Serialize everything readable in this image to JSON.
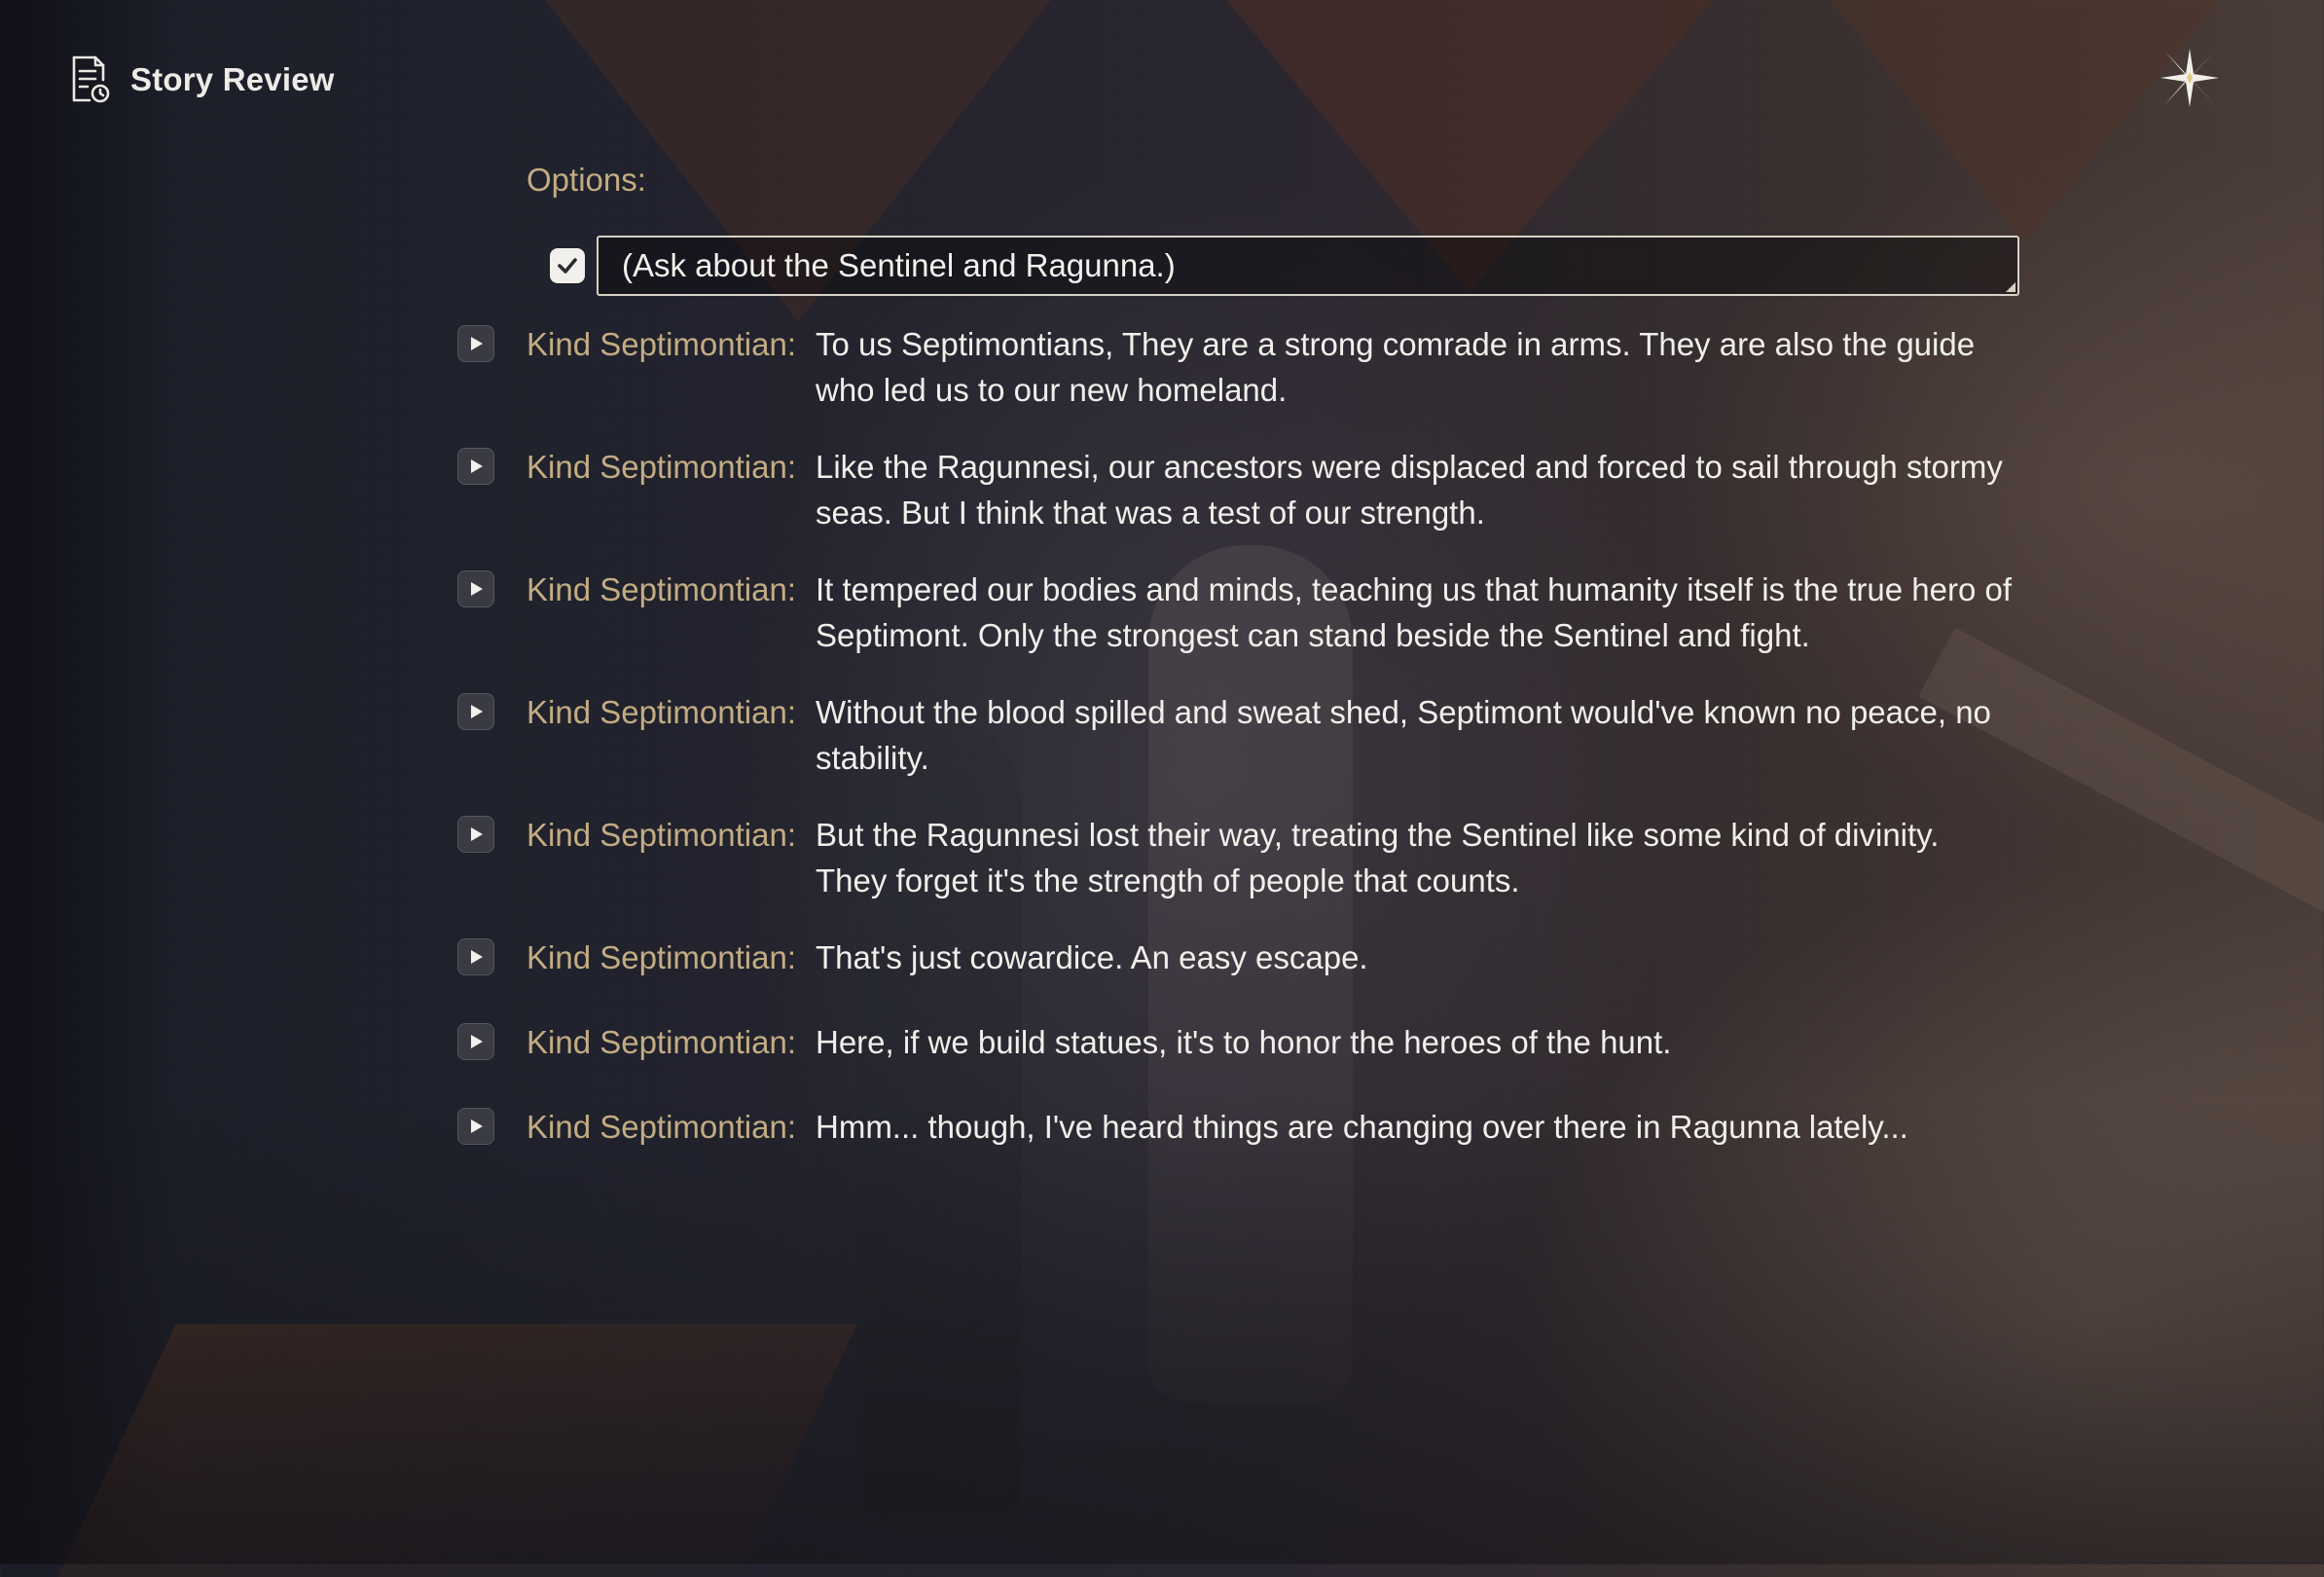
{
  "header": {
    "title": "Story Review",
    "icon": "story-document-icon"
  },
  "close": {
    "icon": "close-star-icon"
  },
  "options": {
    "label": "Options:",
    "selected_option": "(Ask about the Sentinel and Ragunna.)",
    "checked": true
  },
  "dialogue": [
    {
      "speaker": "Kind Septimontian:",
      "text": "To us Septimontians, They are a strong comrade in arms. They are also the guide who led us to our new homeland."
    },
    {
      "speaker": "Kind Septimontian:",
      "text": "Like the Ragunnesi, our ancestors were displaced and forced to sail through stormy seas. But I think that was a test of our strength."
    },
    {
      "speaker": "Kind Septimontian:",
      "text": "It tempered our bodies and minds, teaching us that humanity itself is the true hero of Septimont. Only the strongest can stand beside the Sentinel and fight."
    },
    {
      "speaker": "Kind Septimontian:",
      "text": "Without the blood spilled and sweat shed, Septimont would've known no peace, no stability."
    },
    {
      "speaker": "Kind Septimontian:",
      "text": "But the Ragunnesi lost their way, treating the Sentinel like some kind of divinity. They forget it's the strength of people that counts."
    },
    {
      "speaker": "Kind Septimontian:",
      "text": "That's just cowardice. An easy escape."
    },
    {
      "speaker": "Kind Septimontian:",
      "text": "Here, if we build statues, it's to honor the heroes of the hunt."
    },
    {
      "speaker": "Kind Septimontian:",
      "text": "Hmm... though, I've heard things are changing over there in Ragunna lately..."
    }
  ],
  "colors": {
    "speaker": "#c3ac82",
    "text": "#f0efea",
    "accent_label": "#c3ac82"
  }
}
